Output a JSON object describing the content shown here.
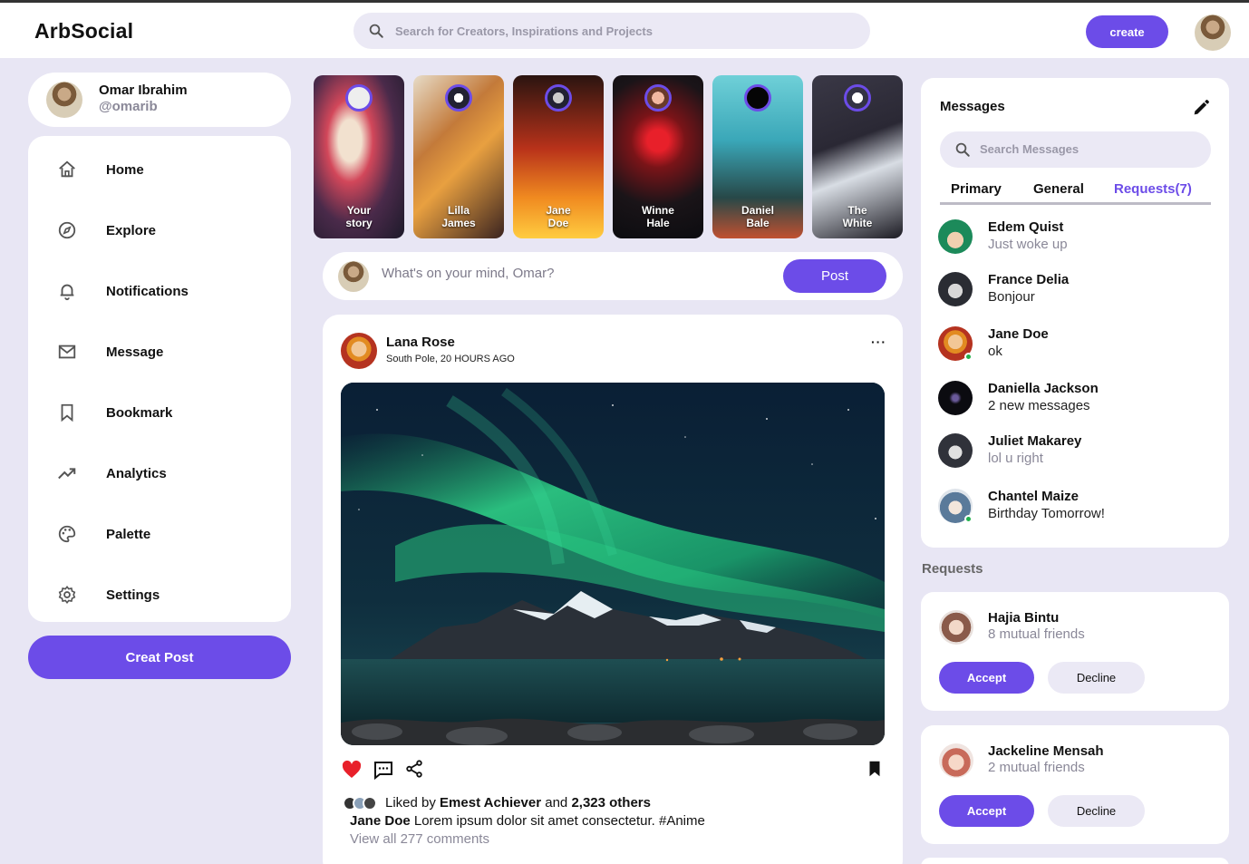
{
  "app": {
    "title": "ArbSocial"
  },
  "search": {
    "placeholder": "Search for Creators, Inspirations and Projects"
  },
  "header": {
    "create_label": "create"
  },
  "profile": {
    "name": "Omar Ibrahim",
    "handle": "@omarib"
  },
  "sidebar": {
    "items": [
      {
        "label": "Home",
        "icon": "home-icon"
      },
      {
        "label": "Explore",
        "icon": "compass-icon"
      },
      {
        "label": "Notifications",
        "icon": "bell-icon"
      },
      {
        "label": "Message",
        "icon": "mail-icon"
      },
      {
        "label": "Bookmark",
        "icon": "bookmark-icon"
      },
      {
        "label": "Analytics",
        "icon": "trending-up-icon"
      },
      {
        "label": "Palette",
        "icon": "palette-icon"
      },
      {
        "label": "Settings",
        "icon": "gear-icon"
      }
    ],
    "create_post_label": "Creat Post"
  },
  "stories": [
    {
      "line1": "Your",
      "line2": "story"
    },
    {
      "line1": "Lilla",
      "line2": "James"
    },
    {
      "line1": "Jane",
      "line2": "Doe"
    },
    {
      "line1": "Winne",
      "line2": "Hale"
    },
    {
      "line1": "Daniel",
      "line2": "Bale"
    },
    {
      "line1": "The",
      "line2": "White"
    }
  ],
  "composer": {
    "placeholder": "What's on your mind, Omar?",
    "post_label": "Post"
  },
  "feed": {
    "author": "Lana Rose",
    "location": "South Pole, 20 HOURS AGO",
    "more": "···",
    "liked_prefix": "Liked by",
    "liked_name": "Emest Achiever",
    "liked_and": "and",
    "liked_others": "2,323 others",
    "caption_author": "Jane Doe",
    "caption_text": "Lorem ipsum dolor sit amet consectetur. #Anime",
    "view_comments": "View all 277 comments",
    "liked": true,
    "heart_color": "#e8202a"
  },
  "messages": {
    "title": "Messages",
    "search_placeholder": "Search Messages",
    "tabs": [
      {
        "label": "Primary"
      },
      {
        "label": "General"
      },
      {
        "label": "Requests(7)"
      }
    ],
    "active_tab": "Requests(7)",
    "conversations": [
      {
        "name": "Edem Quist",
        "text": "Just woke up",
        "online": false,
        "muted": true
      },
      {
        "name": "France Delia",
        "text": "Bonjour",
        "online": false,
        "muted": false
      },
      {
        "name": "Jane Doe",
        "text": "ok",
        "online": true,
        "muted": false
      },
      {
        "name": "Daniella Jackson",
        "text": "2 new messages",
        "online": false,
        "muted": false
      },
      {
        "name": "Juliet Makarey",
        "text": "lol u right",
        "online": false,
        "muted": true
      },
      {
        "name": "Chantel Maize",
        "text": "Birthday Tomorrow!",
        "online": true,
        "muted": false
      }
    ]
  },
  "requests": {
    "title": "Requests",
    "items": [
      {
        "name": "Hajia Bintu",
        "mutual": "8 mutual friends",
        "accept": "Accept",
        "decline": "Decline"
      },
      {
        "name": "Jackeline Mensah",
        "mutual": "2 mutual friends",
        "accept": "Accept",
        "decline": "Decline"
      }
    ]
  },
  "colors": {
    "accent": "#6c4ce8",
    "background": "#e8e6f4",
    "online": "#22b14c"
  }
}
